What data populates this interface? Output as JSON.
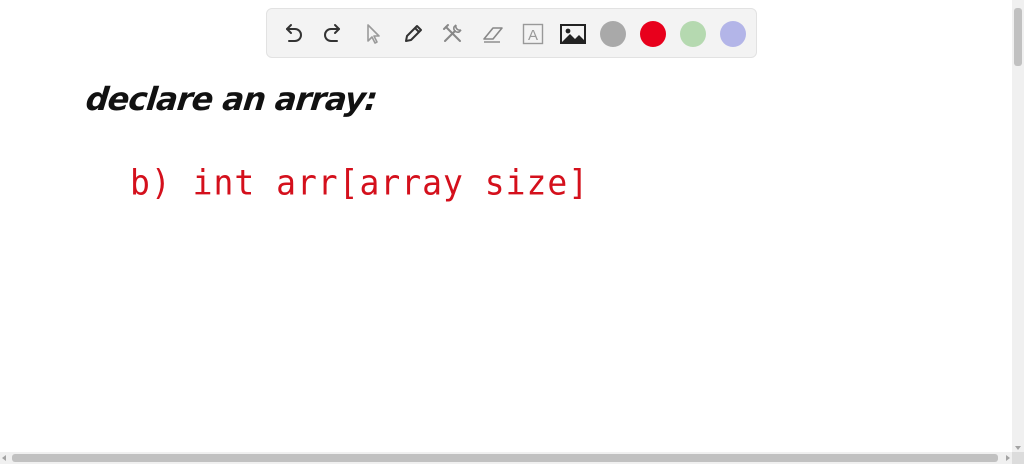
{
  "toolbar": {
    "tools": [
      {
        "name": "undo-icon"
      },
      {
        "name": "redo-icon"
      },
      {
        "name": "pointer-icon"
      },
      {
        "name": "pen-icon"
      },
      {
        "name": "tools-icon"
      },
      {
        "name": "eraser-icon"
      },
      {
        "name": "text-icon",
        "glyph": "A"
      },
      {
        "name": "image-icon"
      }
    ],
    "colors": [
      {
        "name": "gray",
        "hex": "#a9a9a9"
      },
      {
        "name": "red",
        "hex": "#e8001c"
      },
      {
        "name": "green",
        "hex": "#b5d9b0"
      },
      {
        "name": "lavender",
        "hex": "#b3b5e8"
      }
    ],
    "selected_color": "red"
  },
  "whiteboard": {
    "line1": "declare an array:",
    "line2": "b) int arr[array size]"
  }
}
